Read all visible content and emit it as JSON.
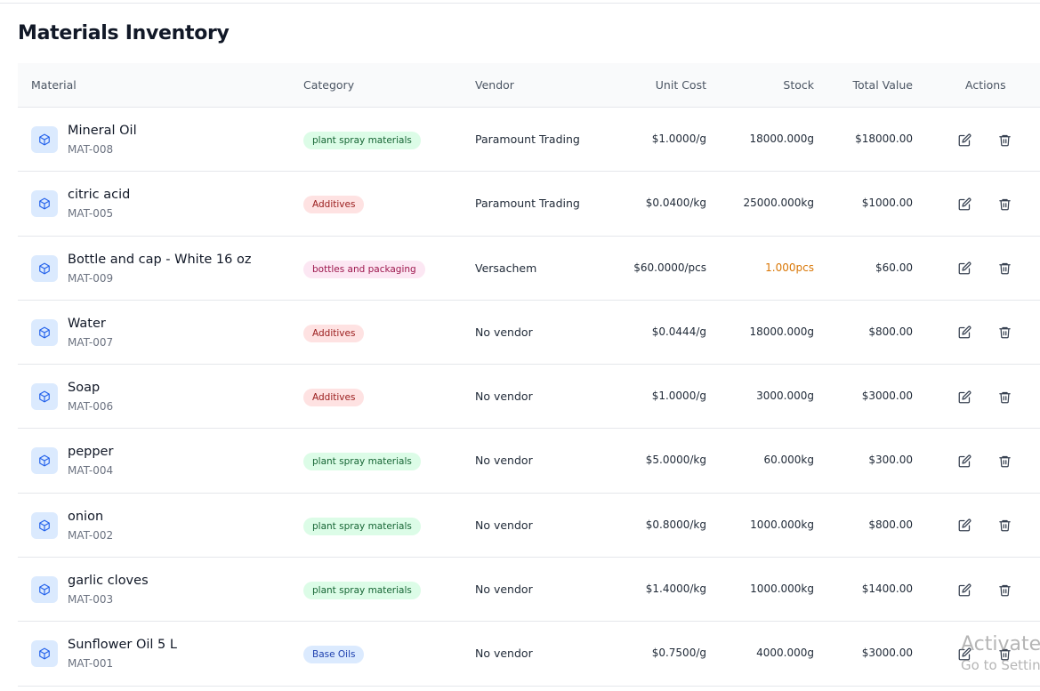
{
  "page": {
    "title": "Materials Inventory"
  },
  "table": {
    "columns": {
      "material": "Material",
      "category": "Category",
      "vendor": "Vendor",
      "unit_cost": "Unit Cost",
      "stock": "Stock",
      "total_value": "Total Value",
      "actions": "Actions"
    },
    "rows": [
      {
        "name": "Mineral Oil",
        "code": "MAT-008",
        "category": "plant spray materials",
        "category_color": "green",
        "vendor": "Paramount Trading",
        "unit_cost": "$1.0000/g",
        "stock": "18000.000g",
        "low_stock": false,
        "total": "$18000.00"
      },
      {
        "name": "citric acid",
        "code": "MAT-005",
        "category": "Additives",
        "category_color": "red",
        "vendor": "Paramount Trading",
        "unit_cost": "$0.0400/kg",
        "stock": "25000.000kg",
        "low_stock": false,
        "total": "$1000.00"
      },
      {
        "name": "Bottle and cap - White 16 oz",
        "code": "MAT-009",
        "category": "bottles and packaging",
        "category_color": "pink",
        "vendor": "Versachem",
        "unit_cost": "$60.0000/pcs",
        "stock": "1.000pcs",
        "low_stock": true,
        "total": "$60.00"
      },
      {
        "name": "Water",
        "code": "MAT-007",
        "category": "Additives",
        "category_color": "red",
        "vendor": "No vendor",
        "unit_cost": "$0.0444/g",
        "stock": "18000.000g",
        "low_stock": false,
        "total": "$800.00"
      },
      {
        "name": "Soap",
        "code": "MAT-006",
        "category": "Additives",
        "category_color": "red",
        "vendor": "No vendor",
        "unit_cost": "$1.0000/g",
        "stock": "3000.000g",
        "low_stock": false,
        "total": "$3000.00"
      },
      {
        "name": "pepper",
        "code": "MAT-004",
        "category": "plant spray materials",
        "category_color": "green",
        "vendor": "No vendor",
        "unit_cost": "$5.0000/kg",
        "stock": "60.000kg",
        "low_stock": false,
        "total": "$300.00"
      },
      {
        "name": "onion",
        "code": "MAT-002",
        "category": "plant spray materials",
        "category_color": "green",
        "vendor": "No vendor",
        "unit_cost": "$0.8000/kg",
        "stock": "1000.000kg",
        "low_stock": false,
        "total": "$800.00"
      },
      {
        "name": "garlic cloves",
        "code": "MAT-003",
        "category": "plant spray materials",
        "category_color": "green",
        "vendor": "No vendor",
        "unit_cost": "$1.4000/kg",
        "stock": "1000.000kg",
        "low_stock": false,
        "total": "$1400.00"
      },
      {
        "name": "Sunflower Oil 5 L",
        "code": "MAT-001",
        "category": "Base Oils",
        "category_color": "blue",
        "vendor": "No vendor",
        "unit_cost": "$0.7500/g",
        "stock": "4000.000g",
        "low_stock": false,
        "total": "$3000.00"
      }
    ]
  },
  "icons": {
    "material": "cube-icon",
    "edit": "edit-icon",
    "delete": "trash-icon"
  },
  "watermark": {
    "line1": "Activate",
    "line2": "Go to Settings"
  }
}
